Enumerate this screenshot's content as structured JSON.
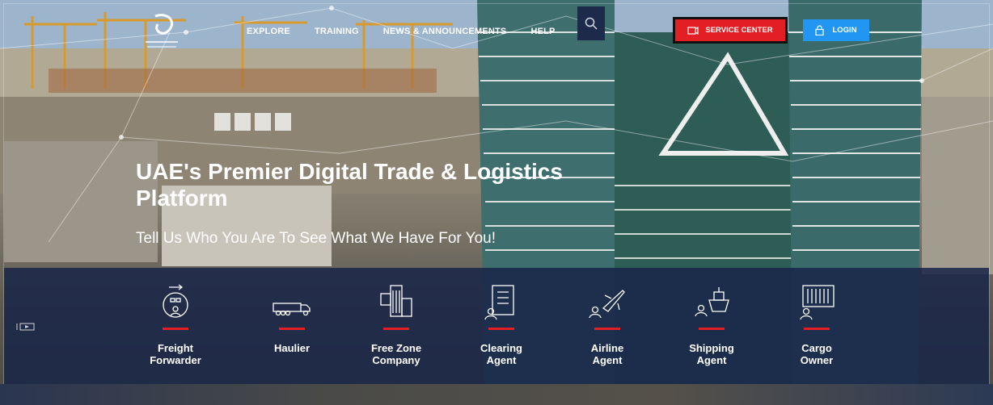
{
  "nav": {
    "items": [
      {
        "label": "EXPLORE",
        "name": "nav-explore"
      },
      {
        "label": "TRAINING",
        "name": "nav-training"
      },
      {
        "label": "NEWS & ANNOUNCEMENTS",
        "name": "nav-news"
      },
      {
        "label": "HELP",
        "name": "nav-help"
      }
    ],
    "search_icon": "search-icon"
  },
  "header": {
    "service_center_label": "SERVICE CENTER",
    "login_label": "LOGIN"
  },
  "hero": {
    "headline": "UAE's Premier Digital Trade & Logistics Platform",
    "subheadline": "Tell Us Who You Are To See What We Have For You!"
  },
  "roles": [
    {
      "label": "Freight\nForwarder",
      "icon": "freight-forwarder-icon"
    },
    {
      "label": "Haulier",
      "icon": "truck-icon"
    },
    {
      "label": "Free Zone\nCompany",
      "icon": "building-icon"
    },
    {
      "label": "Clearing\nAgent",
      "icon": "document-icon"
    },
    {
      "label": "Airline\nAgent",
      "icon": "airplane-icon"
    },
    {
      "label": "Shipping\nAgent",
      "icon": "ship-icon"
    },
    {
      "label": "Cargo\nOwner",
      "icon": "container-icon"
    }
  ],
  "colors": {
    "accent_red": "#e31e24",
    "login_blue": "#2196f3",
    "band_navy": "#182548"
  }
}
